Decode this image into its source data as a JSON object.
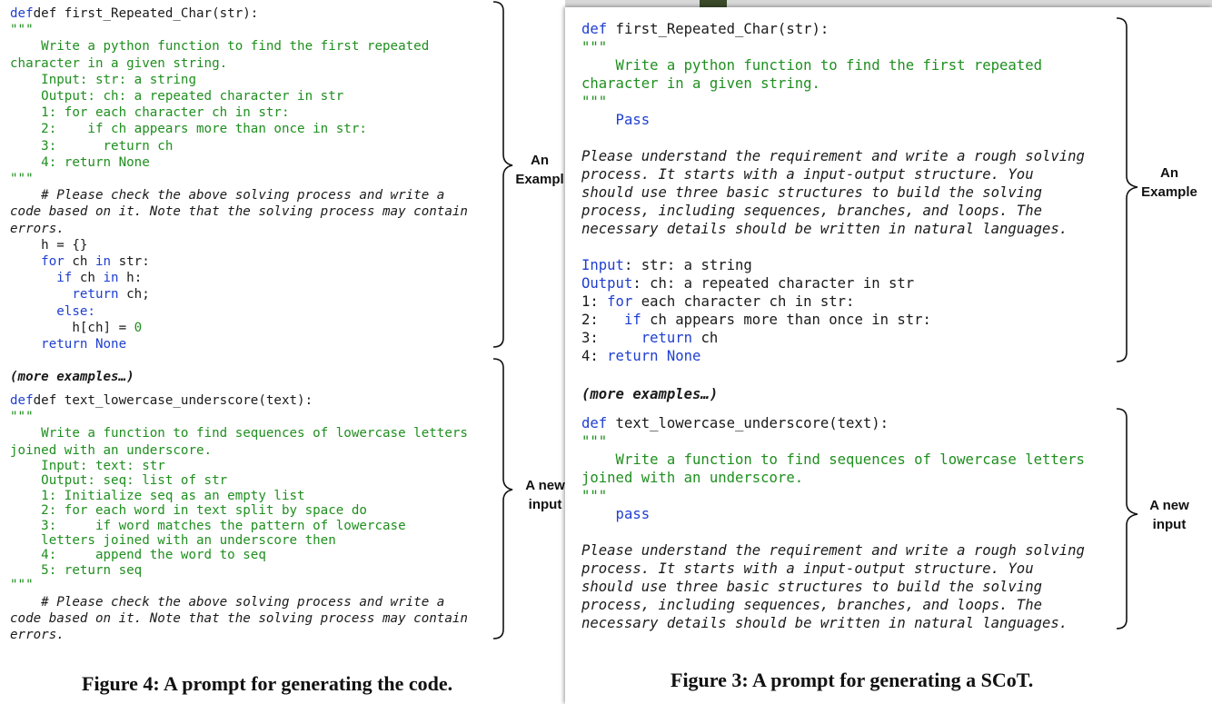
{
  "left": {
    "block1": {
      "signature": "def first_Repeated_Char(str):",
      "q": "\"\"\"",
      "doc1": "    Write a python function to find the first repeated",
      "doc2": "character in a given string.",
      "io1": "    Input: str: a string",
      "io2": "    Output: ch: a repeated character in str",
      "io3": "    1: for each character ch in str:",
      "io4": "    2:    if ch appears more than once in str:",
      "io5": "    3:      return ch",
      "io6": "    4: return None",
      "c1": "    # Please check the above solving process and write a",
      "c2": "code based on it. Note that the solving process may contain",
      "c3": "errors.",
      "h": "    h = {}",
      "for_kw": "for",
      "for_a": " ch ",
      "in_kw": "in",
      "for_b": " str:",
      "if_kw": "if",
      "if_a": " ch ",
      "if_b": " h:",
      "ret_kw": "return",
      "ret_a": " ch;",
      "else_kw": "else:",
      "assign_a": "        h[ch] = ",
      "zero": "0",
      "ret2_kw": "return",
      "none": " None"
    },
    "more": "(more examples…)",
    "block2": {
      "signature": "def text_lowercase_underscore(text):",
      "q": "\"\"\"",
      "doc1": "    Write a function to find sequences of lowercase letters",
      "doc2": "joined with an underscore.",
      "io1": "    Input: text: str",
      "io2": "    Output: seq: list of str",
      "io3": "    1: Initialize seq as an empty list",
      "io4": "    2: for each word in text split by space do",
      "io5": "    3:     if word matches the pattern of lowercase",
      "io6": "    letters joined with an underscore then",
      "io7": "    4:     append the word to seq",
      "io8": "    5: return seq",
      "c1": "    # Please check the above solving process and write a",
      "c2": "code based on it. Note that the solving process may contain",
      "c3": "errors."
    },
    "anno1": "An\nExampl",
    "anno2": "A new\ninput",
    "caption": "Figure 4: A prompt for generating the code."
  },
  "right": {
    "block1": {
      "def_kw": "def",
      "signature": " first_Repeated_Char(str):",
      "q": "\"\"\"",
      "doc1": "    Write a python function to find the first repeated",
      "doc2": "character in a given string.",
      "pass": "    Pass",
      "inst1": "Please understand the requirement and write a rough solving",
      "inst2": "process. It starts with a input-output structure. You",
      "inst3": "should use three basic structures to build the solving",
      "inst4": "process, including sequences, branches, and loops. The",
      "inst5": "necessary details should be written in natural languages.",
      "in_kw": "Input",
      "in_rest": ": str: a string",
      "out_kw": "Output",
      "out_rest": ": ch: a repeated character in str",
      "s1a": "1: ",
      "s1_kw": "for",
      "s1b": " each character ch in str:",
      "s2a": "2:   ",
      "s2_kw": "if",
      "s2b": " ch appears more than once in str:",
      "s3a": "3:     ",
      "s3_kw": "return",
      "s3b": " ch",
      "s4a": "4: ",
      "s4_kw": "return None"
    },
    "more": "(more examples…)",
    "block2": {
      "def_kw": "def",
      "signature": " text_lowercase_underscore(text):",
      "q": "\"\"\"",
      "doc1": "    Write a function to find sequences of lowercase letters",
      "doc2": "joined with an underscore.",
      "pass": "    pass",
      "inst1": "Please understand the requirement and write a rough solving",
      "inst2": "process. It starts with a input-output structure. You",
      "inst3": "should use three basic structures to build the solving",
      "inst4": "process, including sequences, branches, and loops. The",
      "inst5": "necessary details should be written in natural languages."
    },
    "anno1": "An\nExample",
    "anno2": "A new\ninput",
    "caption": "Figure 3: A prompt for generating a SCoT."
  },
  "colors": {
    "keyword": "#1f3fd0",
    "string": "#1f8f1f",
    "text": "#1a1a1a"
  }
}
